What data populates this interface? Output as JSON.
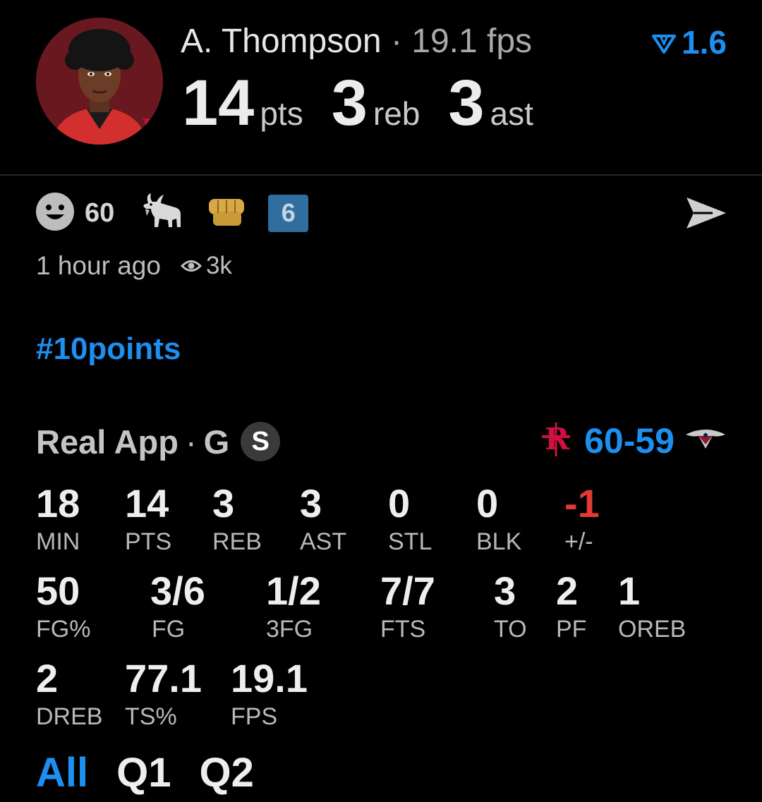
{
  "header": {
    "player_name": "A. Thompson",
    "fps_label": "19.1 fps",
    "rating": "1.6",
    "headline_stats": [
      {
        "value": "14",
        "label": "pts"
      },
      {
        "value": "3",
        "label": "reb"
      },
      {
        "value": "3",
        "label": "ast"
      }
    ]
  },
  "reactions": {
    "smile_count": "60",
    "badge_count": "6"
  },
  "meta": {
    "time_ago": "1 hour ago",
    "views": "3k"
  },
  "hashtag": "#10points",
  "game": {
    "source": "Real App",
    "position": "G",
    "badge": "S",
    "score_home": "60",
    "score_away": "59",
    "stats_row1": [
      {
        "value": "18",
        "label": "MIN"
      },
      {
        "value": "14",
        "label": "PTS"
      },
      {
        "value": "3",
        "label": "REB"
      },
      {
        "value": "3",
        "label": "AST"
      },
      {
        "value": "0",
        "label": "STL"
      },
      {
        "value": "0",
        "label": "BLK"
      },
      {
        "value": "-1",
        "label": "+/-"
      }
    ],
    "stats_row2": [
      {
        "value": "50",
        "label": "FG%"
      },
      {
        "value": "3/6",
        "label": "FG"
      },
      {
        "value": "1/2",
        "label": "3FG"
      },
      {
        "value": "7/7",
        "label": "FTS"
      },
      {
        "value": "3",
        "label": "TO"
      },
      {
        "value": "2",
        "label": "PF"
      },
      {
        "value": "1",
        "label": "OREB"
      }
    ],
    "stats_row3": [
      {
        "value": "2",
        "label": "DREB"
      },
      {
        "value": "77.1",
        "label": "TS%"
      },
      {
        "value": "19.1",
        "label": "FPS"
      }
    ]
  },
  "tabs": [
    {
      "label": "All",
      "active": true
    },
    {
      "label": "Q1",
      "active": false
    },
    {
      "label": "Q2",
      "active": false
    }
  ],
  "colors": {
    "accent": "#1c8ff0",
    "negative": "#e53935",
    "rockets_red": "#ce1141"
  },
  "icons": {
    "avatar": "player-photo",
    "rating": "rating-arrow-icon",
    "smile": "smile-icon",
    "goat": "goat-icon",
    "fist": "fist-icon",
    "send": "send-icon",
    "views": "eye-icon",
    "home_logo": "rockets-logo-icon",
    "away_logo": "pelicans-logo-icon"
  }
}
